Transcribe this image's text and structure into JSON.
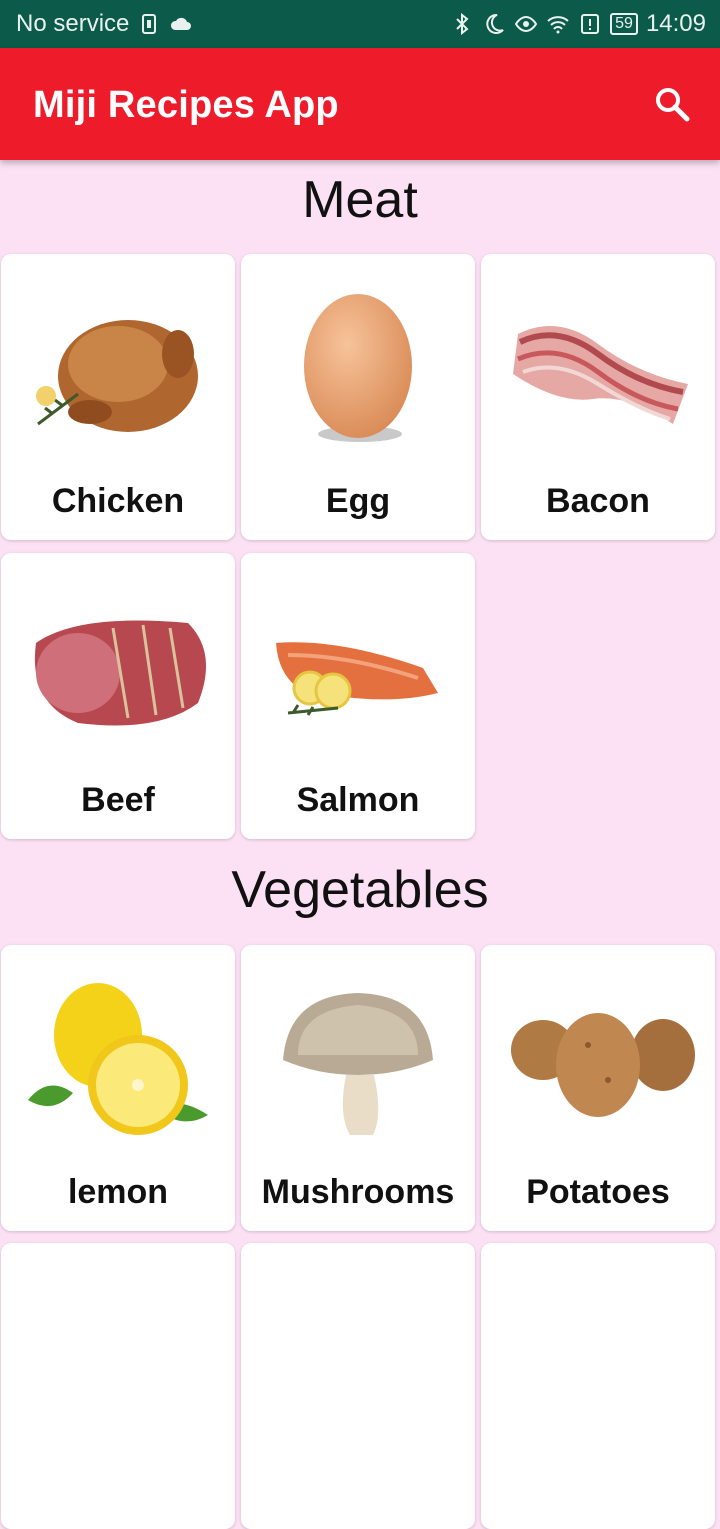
{
  "status_bar": {
    "carrier": "No service",
    "battery": "59",
    "time": "14:09"
  },
  "app_bar": {
    "title": "Miji Recipes App",
    "search_icon": "search-icon"
  },
  "sections": [
    {
      "title": "Meat",
      "items": [
        {
          "label": "Chicken"
        },
        {
          "label": "Egg"
        },
        {
          "label": "Bacon"
        },
        {
          "label": "Beef"
        },
        {
          "label": "Salmon"
        }
      ]
    },
    {
      "title": "Vegetables",
      "items": [
        {
          "label": "lemon"
        },
        {
          "label": "Mushrooms"
        },
        {
          "label": "Potatoes"
        }
      ]
    }
  ],
  "colors": {
    "status_bar": "#0b5a4a",
    "app_bar": "#ee1c2b",
    "background": "#fce1f5"
  }
}
